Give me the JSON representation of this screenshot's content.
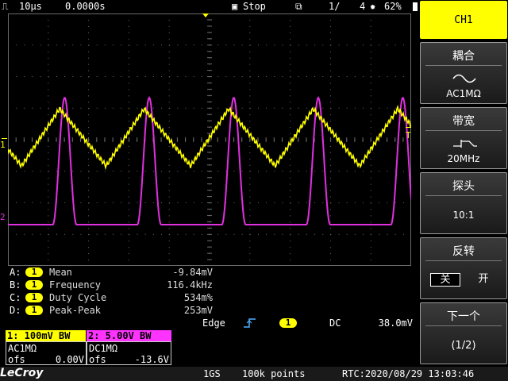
{
  "topbar": {
    "timebase": "10µs",
    "delay": "0.0000s",
    "run_state": "Stop",
    "page": "1/",
    "pages_total": "4",
    "battery": "62%"
  },
  "menu": {
    "channel": "CH1",
    "coupling_title": "耦合",
    "coupling_value": "AC1MΩ",
    "bandwidth_title": "带宽",
    "bandwidth_value": "20MHz",
    "probe_title": "探头",
    "probe_value": "10:1",
    "invert_title": "反转",
    "invert_off": "关",
    "invert_on": "开",
    "next_title": "下一个",
    "next_page": "(1/2)"
  },
  "markers": {
    "ch1": "1",
    "ch2": "2",
    "trigger": "T"
  },
  "measurements": [
    {
      "slot": "A:",
      "channel": "1",
      "name": "Mean",
      "value": "-9.84mV"
    },
    {
      "slot": "B:",
      "channel": "1",
      "name": "Frequency",
      "value": "116.4kHz"
    },
    {
      "slot": "C:",
      "channel": "1",
      "name": "Duty Cycle",
      "value": "534m%"
    },
    {
      "slot": "D:",
      "channel": "1",
      "name": "Peak-Peak",
      "value": "253mV"
    }
  ],
  "trigger": {
    "type": "Edge",
    "source": "1",
    "coupling": "DC",
    "level": "38.0mV"
  },
  "channels": {
    "ch1": {
      "header": "1: 100mV  BW",
      "coupling": "AC1MΩ",
      "ofs_label": "ofs",
      "ofs": "0.00V",
      "color": "#ffff00"
    },
    "ch2": {
      "header": "2: 5.00V  BW",
      "coupling": "DC1MΩ",
      "ofs_label": "ofs",
      "ofs": "-13.6V",
      "color": "#ff33ff"
    }
  },
  "bottombar": {
    "brand": "LeCroy",
    "sample_rate": "1GS",
    "points": "100k points",
    "rtc": "RTC:2020/08/29 13:03:46"
  },
  "colors": {
    "ch1": "#ffff00",
    "ch2": "#e030e0",
    "grid": "#6a6a6a"
  }
}
